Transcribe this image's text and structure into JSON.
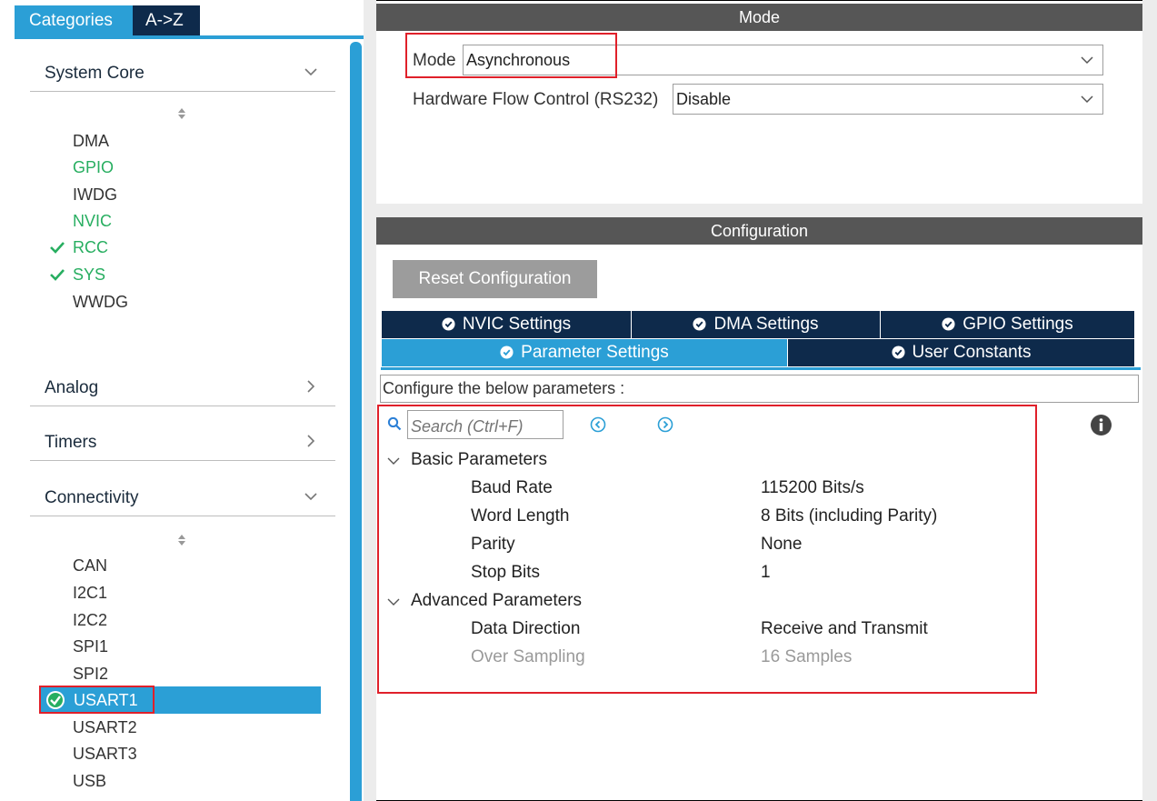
{
  "left_panel": {
    "tabs": [
      "Categories",
      "A->Z"
    ],
    "groups": {
      "system_core": "System Core",
      "analog": "Analog",
      "timers": "Timers",
      "connectivity": "Connectivity"
    },
    "system_core_items": [
      "DMA",
      "GPIO",
      "IWDG",
      "NVIC",
      "RCC",
      "SYS",
      "WWDG"
    ],
    "connectivity_items": [
      "CAN",
      "I2C1",
      "I2C2",
      "SPI1",
      "SPI2",
      "USART1",
      "USART2",
      "USART3",
      "USB"
    ]
  },
  "mode_section": {
    "title": "Mode",
    "mode_label": "Mode",
    "mode_value": "Asynchronous",
    "hfc_label": "Hardware Flow Control (RS232)",
    "hfc_value": "Disable"
  },
  "config_section": {
    "title": "Configuration",
    "reset_label": "Reset Configuration",
    "tabs": [
      "NVIC Settings",
      "DMA Settings",
      "GPIO Settings",
      "Parameter Settings",
      "User Constants"
    ],
    "caption": "Configure the below parameters :",
    "search_placeholder": "Search (Ctrl+F)"
  },
  "parameters": {
    "basic_title": "Basic Parameters",
    "basic": [
      {
        "name": "Baud Rate",
        "value": "115200 Bits/s"
      },
      {
        "name": "Word Length",
        "value": "8 Bits (including Parity)"
      },
      {
        "name": "Parity",
        "value": "None"
      },
      {
        "name": "Stop Bits",
        "value": "1"
      }
    ],
    "advanced_title": "Advanced Parameters",
    "advanced": [
      {
        "name": "Data Direction",
        "value": "Receive and Transmit"
      },
      {
        "name": "Over Sampling",
        "value": "16 Samples"
      }
    ]
  },
  "colors": {
    "accent_blue": "#2b9fd6",
    "navy": "#0e2a4b",
    "enabled_green": "#27ae60",
    "highlight_red": "#e0202a",
    "header_grey": "#565656"
  }
}
